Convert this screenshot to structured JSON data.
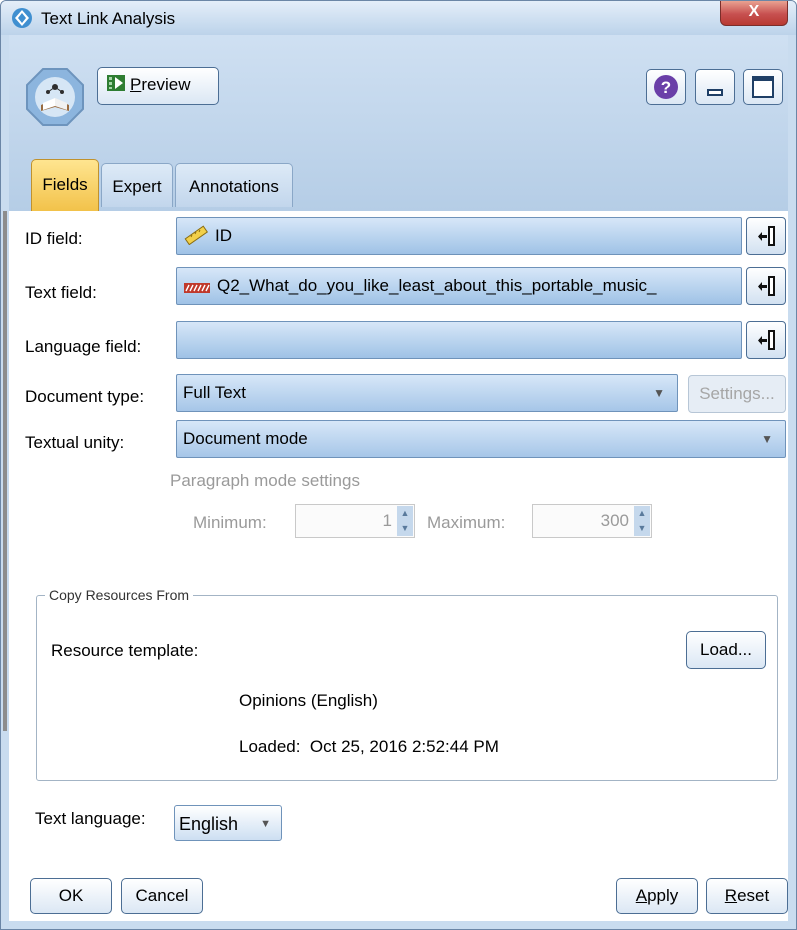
{
  "window": {
    "title": "Text Link Analysis",
    "close_glyph": "X"
  },
  "toolbar": {
    "preview_label": "Preview",
    "preview_mnemonic": "P",
    "preview_rest": "review"
  },
  "tabs": [
    {
      "label": "Fields",
      "active": true
    },
    {
      "label": "Expert",
      "active": false
    },
    {
      "label": "Annotations",
      "active": false
    }
  ],
  "fields": {
    "id_label": "ID field:",
    "id_value": "ID",
    "text_label": "Text field:",
    "text_value": "Q2_What_do_you_like_least_about_this_portable_music_",
    "language_label": "Language field:",
    "language_value": "",
    "doctype_label": "Document type:",
    "doctype_value": "Full Text",
    "settings_label": "Settings...",
    "unity_label": "Textual unity:",
    "unity_value": "Document mode",
    "paragraph_label": "Paragraph mode settings",
    "minimum_label": "Minimum:",
    "minimum_value": "1",
    "maximum_label": "Maximum:",
    "maximum_value": "300"
  },
  "resources": {
    "group_title": "Copy Resources From",
    "template_label": "Resource template:",
    "load_label": "Load...",
    "template_name": "Opinions (English)",
    "loaded_label": "Loaded:",
    "loaded_date": "Oct 25, 2016 2:52:44 PM"
  },
  "text_language": {
    "label": "Text language:",
    "value": "English"
  },
  "buttons": {
    "ok": "OK",
    "cancel": "Cancel",
    "apply_mnemonic": "A",
    "apply_rest": "pply",
    "reset_mnemonic": "R",
    "reset_rest": "eset"
  },
  "colors": {
    "accent": "#f2c24a",
    "field_blue": "#a6c6e8",
    "title_bar": "#c9dcef",
    "close": "#c75050"
  }
}
